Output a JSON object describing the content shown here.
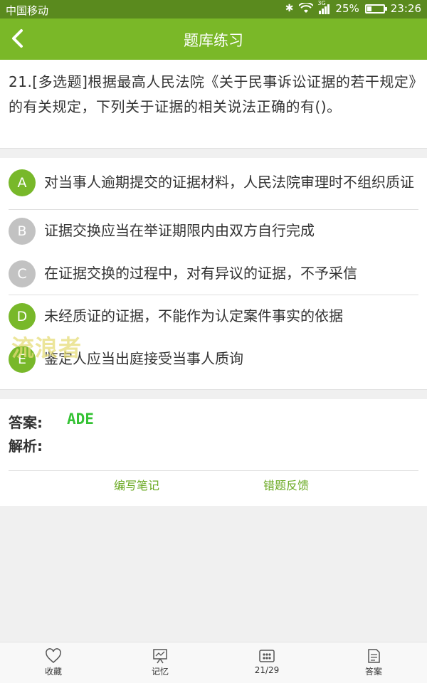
{
  "status_bar": {
    "carrier": "中国移动",
    "network": "3G",
    "battery_percent": "25%",
    "battery_level": 0.25,
    "time": "23:26"
  },
  "header": {
    "title": "题库练习",
    "back_icon": "chevron-left-icon"
  },
  "question": {
    "text": "21.[多选题]根据最高人民法院《关于民事诉讼证据的若干规定》的有关规定，下列关于证据的相关说法正确的有()。"
  },
  "options": [
    {
      "letter": "A",
      "text": "对当事人逾期提交的证据材料，人民法院审理时不组织质证",
      "selected": true
    },
    {
      "letter": "B",
      "text": "证据交换应当在举证期限内由双方自行完成",
      "selected": false
    },
    {
      "letter": "C",
      "text": "在证据交换的过程中，对有异议的证据，不予采信",
      "selected": false
    },
    {
      "letter": "D",
      "text": "未经质证的证据，不能作为认定案件事实的依据",
      "selected": true
    },
    {
      "letter": "E",
      "text": "鉴定人应当出庭接受当事人质询",
      "selected": true
    }
  ],
  "watermark": "流浪者",
  "answer": {
    "label": "答案:",
    "value": "ADE",
    "analysis_label": "解析:"
  },
  "actions": {
    "write_note": "编写笔记",
    "error_feedback": "错题反馈"
  },
  "bottom_nav": {
    "favorite": "收藏",
    "memory": "记忆",
    "progress": "21/29",
    "answer": "答案"
  },
  "colors": {
    "header_green": "#7ab828",
    "status_green": "#5a8a1e",
    "option_selected": "#78b82a",
    "option_unselected": "#c2c2c2",
    "answer_text": "#34c234",
    "action_text": "#6aa922"
  }
}
